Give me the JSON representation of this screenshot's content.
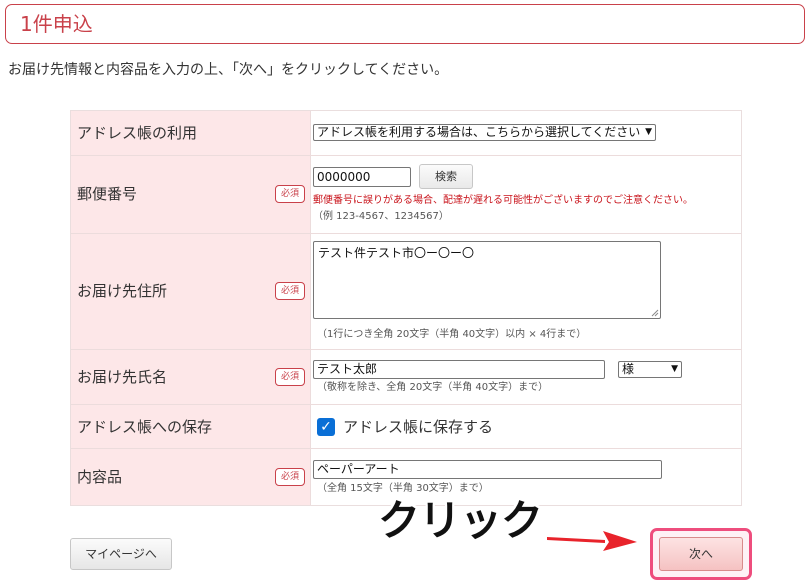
{
  "page": {
    "title": "1件申込",
    "instruction": "お届け先情報と内容品を入力の上、「次へ」をクリックしてください。"
  },
  "form": {
    "required_badge": "必須",
    "rows": {
      "address_book": {
        "label": "アドレス帳の利用",
        "select_value": "アドレス帳を利用する場合は、こちらから選択してください"
      },
      "postal": {
        "label": "郵便番号",
        "value": "0000000",
        "search_button": "検索",
        "warning": "郵便番号に誤りがある場合、配達が遅れる可能性がございますのでご注意ください。",
        "example": "（例 123-4567、1234567）"
      },
      "address": {
        "label": "お届け先住所",
        "value": "テスト件テスト市〇ー〇ー〇",
        "note": "（1行につき全角 20文字（半角 40文字）以内 × 4行まで）"
      },
      "name": {
        "label": "お届け先氏名",
        "value": "テスト太郎",
        "honorific": "様",
        "note": "（敬称を除き、全角 20文字（半角 40文字）まで）"
      },
      "save": {
        "label": "アドレス帳への保存",
        "checkbox_label": "アドレス帳に保存する",
        "checked": true
      },
      "contents": {
        "label": "内容品",
        "value": "ペーパーアート",
        "note": "（全角 15文字（半角 30文字）まで）"
      }
    }
  },
  "buttons": {
    "mypage": "マイページへ",
    "next": "次へ"
  },
  "annotation": {
    "text": "クリック",
    "arrow_color": "#e8232b",
    "highlight_color": "#ee4d7d"
  },
  "colors": {
    "accent": "#c9414a",
    "label_bg": "#fde7e8",
    "warning": "#c9141c",
    "checkbox": "#0a6fd6"
  }
}
